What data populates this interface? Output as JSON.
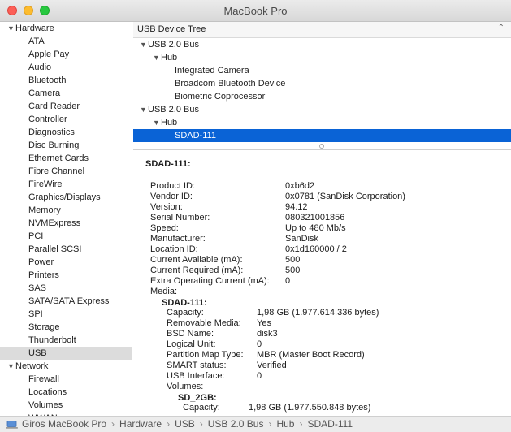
{
  "window": {
    "title": "MacBook Pro"
  },
  "sidebar": {
    "groups": [
      {
        "label": "Hardware",
        "items": [
          "ATA",
          "Apple Pay",
          "Audio",
          "Bluetooth",
          "Camera",
          "Card Reader",
          "Controller",
          "Diagnostics",
          "Disc Burning",
          "Ethernet Cards",
          "Fibre Channel",
          "FireWire",
          "Graphics/Displays",
          "Memory",
          "NVMExpress",
          "PCI",
          "Parallel SCSI",
          "Power",
          "Printers",
          "SAS",
          "SATA/SATA Express",
          "SPI",
          "Storage",
          "Thunderbolt",
          "USB"
        ]
      },
      {
        "label": "Network",
        "items": [
          "Firewall",
          "Locations",
          "Volumes",
          "WWAN"
        ]
      }
    ],
    "selected": "USB"
  },
  "tree": {
    "header": "USB Device Tree",
    "rows": [
      {
        "label": "USB 2.0 Bus",
        "level": 0,
        "expandable": true
      },
      {
        "label": "Hub",
        "level": 1,
        "expandable": true
      },
      {
        "label": "Integrated Camera",
        "level": 2,
        "expandable": false
      },
      {
        "label": "Broadcom Bluetooth Device",
        "level": 2,
        "expandable": false
      },
      {
        "label": "Biometric Coprocessor",
        "level": 2,
        "expandable": false
      },
      {
        "label": "USB 2.0 Bus",
        "level": 0,
        "expandable": true
      },
      {
        "label": "Hub",
        "level": 1,
        "expandable": true
      },
      {
        "label": "SDAD-111",
        "level": 2,
        "expandable": false,
        "selected": true
      }
    ]
  },
  "details": {
    "title": "SDAD-111:",
    "properties": [
      {
        "key": "Product ID:",
        "value": "0xb6d2"
      },
      {
        "key": "Vendor ID:",
        "value": "0x0781  (SanDisk Corporation)"
      },
      {
        "key": "Version:",
        "value": "94.12"
      },
      {
        "key": "Serial Number:",
        "value": "080321001856"
      },
      {
        "key": "Speed:",
        "value": "Up to 480 Mb/s"
      },
      {
        "key": "Manufacturer:",
        "value": "SanDisk"
      },
      {
        "key": "Location ID:",
        "value": "0x1d160000 / 2"
      },
      {
        "key": "Current Available (mA):",
        "value": "500"
      },
      {
        "key": "Current Required (mA):",
        "value": "500"
      },
      {
        "key": "Extra Operating Current (mA):",
        "value": "0"
      },
      {
        "key": "Media:",
        "value": ""
      }
    ],
    "media": {
      "title": "SDAD-111:",
      "properties": [
        {
          "key": "Capacity:",
          "value": "1,98 GB (1.977.614.336 bytes)"
        },
        {
          "key": "Removable Media:",
          "value": "Yes"
        },
        {
          "key": "BSD Name:",
          "value": "disk3"
        },
        {
          "key": "Logical Unit:",
          "value": "0"
        },
        {
          "key": "Partition Map Type:",
          "value": "MBR (Master Boot Record)"
        },
        {
          "key": "SMART status:",
          "value": "Verified"
        },
        {
          "key": "USB Interface:",
          "value": "0"
        },
        {
          "key": "Volumes:",
          "value": ""
        }
      ],
      "volume": {
        "title": "SD_2GB:",
        "properties": [
          {
            "key": "Capacity:",
            "value": "1,98 GB (1.977.550.848 bytes)"
          }
        ]
      }
    }
  },
  "statusbar": {
    "breadcrumb": [
      "Giros MacBook Pro",
      "Hardware",
      "USB",
      "USB 2.0 Bus",
      "Hub",
      "SDAD-111"
    ],
    "separator": "›"
  },
  "colors": {
    "selection": "#0a63d6",
    "sidebar_selected": "#dcdcdc"
  }
}
